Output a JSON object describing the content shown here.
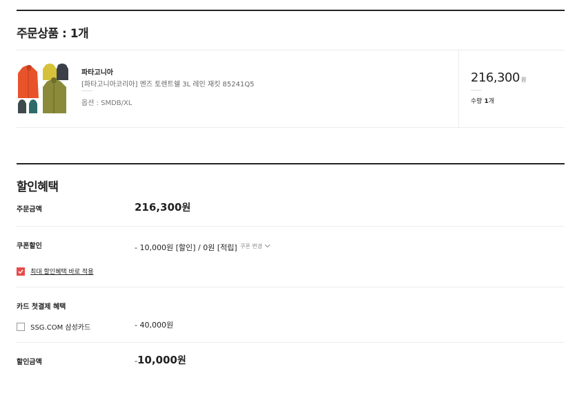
{
  "order": {
    "title": "주문상품 : 1개",
    "product": {
      "brand": "파타고니아",
      "name": "[파타고니아코리아] 멘즈 토렌트쉘 3L 레인 재킷 85241Q5",
      "option": "옵션 : SMDB/XL",
      "price": "216,300",
      "price_unit": "원",
      "qty_label": "수량",
      "qty_value": "1",
      "qty_unit": "개"
    }
  },
  "discount": {
    "title": "할인혜택",
    "order_amount_label": "주문금액",
    "order_amount_value": "216,300",
    "order_amount_unit": "원",
    "coupon_label": "쿠폰할인",
    "coupon_value": "- 10,000원 [할인] / 0원 [적립]",
    "coupon_change": "쿠폰 변경",
    "max_benefit_label": "최대 할인혜택 바로 적용",
    "max_benefit_checked": true,
    "card_label": "카드 첫결제 혜택",
    "card_option": "SSG.COM 삼성카드",
    "card_value": "- 40,000원",
    "total_label": "할인금액",
    "total_prefix": "-",
    "total_value": "10,000",
    "total_unit": "원"
  },
  "colors": {
    "accent": "#e74c4c",
    "text": "#222222",
    "muted": "#666666",
    "line": "#ececec"
  }
}
